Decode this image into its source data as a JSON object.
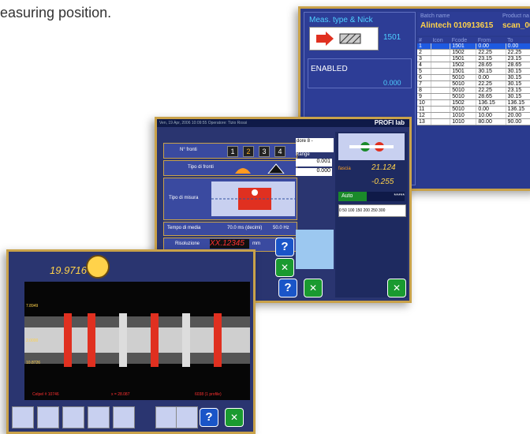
{
  "caption": "easuring position.",
  "batch_window": {
    "meas_title": "Meas. type & Nick",
    "meas_code": "1501",
    "status": "ENABLED",
    "status_value": "0.000",
    "batch_label": "Batch name",
    "batch_name": "Alintech 010913615",
    "product_label": "Product na",
    "product_name": "scan_00",
    "columns": [
      "#",
      "Icon",
      "Fcode",
      "From",
      "To",
      "D"
    ],
    "rows": [
      [
        "1",
        "",
        "1501",
        "0.00",
        "0.00"
      ],
      [
        "2",
        "",
        "1502",
        "22.25",
        "22.25"
      ],
      [
        "3",
        "",
        "1501",
        "23.15",
        "23.15"
      ],
      [
        "4",
        "",
        "1502",
        "28.65",
        "28.65"
      ],
      [
        "5",
        "",
        "1501",
        "30.15",
        "30.15"
      ],
      [
        "6",
        "",
        "5010",
        "0.00",
        "30.15"
      ],
      [
        "7",
        "",
        "5010",
        "22.25",
        "30.15"
      ],
      [
        "8",
        "",
        "5010",
        "22.25",
        "23.15"
      ],
      [
        "9",
        "",
        "5010",
        "28.65",
        "30.15"
      ],
      [
        "10",
        "",
        "1502",
        "136.15",
        "136.15"
      ],
      [
        "11",
        "",
        "5010",
        "0.00",
        "136.15"
      ],
      [
        "12",
        "",
        "1010",
        "10.00",
        "20.00"
      ],
      [
        "13",
        "",
        "1010",
        "80.00",
        "90.00"
      ]
    ]
  },
  "mis_window": {
    "top_bar": "Ven, 19 Apr, 2006    10:09:55      Operatore: Tizio Rossi",
    "brand": "PROFI lab",
    "n_fronti_label": "N° fronti",
    "n_fronti": [
      "1",
      "2",
      "3",
      "4"
    ],
    "tipo_fronti_label": "Tipo di fronti",
    "tipo_misura_label": "Tipo di misura",
    "tempo_label": "Tempo di media",
    "tempo_value": "70.0 ms (decimi)",
    "tempo_hz": "50.0 Hz",
    "risoluzione_label": "Risoluzione",
    "risoluzione_value": "XX.12345",
    "risoluzione_unit": "mm",
    "range_label": "Range",
    "range_min": "0.001",
    "range_max": "0.000",
    "sensor_label": "dore 8 -",
    "fascia_label": "fascia",
    "val_a": "21.124",
    "val_b": "-0.255",
    "auto_label": "Auto",
    "auto_stars": "*****",
    "scale_ticks": "0  50  100  150  200  250  300"
  },
  "profile_window": {
    "value": "19.9716",
    "labels": [
      "7.8949",
      "2.0000",
      "10.8726"
    ],
    "footer_left": "Celpel # 10746",
    "footer_mid": "x = 28.087",
    "footer_right": "6038 (1 profile)"
  }
}
